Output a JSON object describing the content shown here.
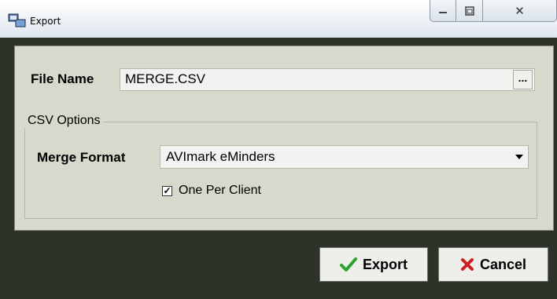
{
  "window": {
    "title": "Export",
    "close_glyph": "✕",
    "icons": {
      "app": "export-app-icon",
      "minimize": "minimize-icon",
      "maximize": "maximize-icon",
      "close": "close-icon"
    }
  },
  "file": {
    "label": "File Name",
    "value": "MERGE.CSV",
    "browse_label": "..."
  },
  "csv_options": {
    "group_label": "CSV Options",
    "merge_format_label": "Merge Format",
    "merge_format_value": "AVImark eMinders",
    "one_per_client": {
      "label": "One Per Client",
      "checked_glyph": "✓"
    }
  },
  "buttons": {
    "export_label": "Export",
    "export_icon": "checkmark-icon",
    "cancel_label": "Cancel",
    "cancel_icon": "x-icon"
  },
  "colors": {
    "check_green": "#2aa32a",
    "cancel_red": "#cc1f1f",
    "panel": "#d8d8cc",
    "frame": "#2c3329"
  }
}
